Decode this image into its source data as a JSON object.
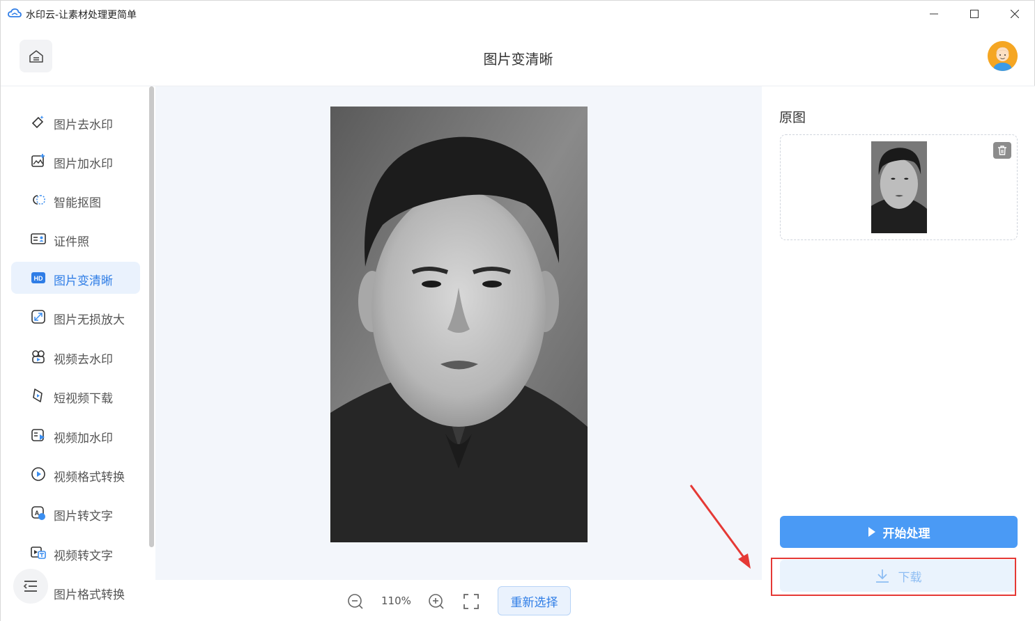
{
  "window": {
    "title": "水印云-让素材处理更简单",
    "controls": [
      "minimize-icon",
      "maximize-icon",
      "close-icon"
    ]
  },
  "header": {
    "title": "图片变清晰"
  },
  "sidebar": {
    "items": [
      {
        "label": "图片去水印",
        "icon": "eraser-icon",
        "active": false
      },
      {
        "label": "图片加水印",
        "icon": "image-add-icon",
        "active": false
      },
      {
        "label": "智能抠图",
        "icon": "cutout-icon",
        "active": false
      },
      {
        "label": "证件照",
        "icon": "id-card-icon",
        "active": false
      },
      {
        "label": "图片变清晰",
        "icon": "hd-icon",
        "active": true
      },
      {
        "label": "图片无损放大",
        "icon": "enlarge-icon",
        "active": false
      },
      {
        "label": "视频去水印",
        "icon": "video-eraser-icon",
        "active": false
      },
      {
        "label": "短视频下载",
        "icon": "video-download-icon",
        "active": false
      },
      {
        "label": "视频加水印",
        "icon": "video-watermark-icon",
        "active": false
      },
      {
        "label": "视频格式转换",
        "icon": "video-convert-icon",
        "active": false
      },
      {
        "label": "图片转文字",
        "icon": "image-text-icon",
        "active": false
      },
      {
        "label": "视频转文字",
        "icon": "video-text-icon",
        "active": false
      },
      {
        "label": "图片格式转换",
        "icon": "image-convert-icon",
        "active": false
      }
    ]
  },
  "toolbar": {
    "zoom": "110%",
    "reselect_label": "重新选择"
  },
  "right_panel": {
    "original_label": "原图",
    "start_label": "开始处理",
    "download_label": "下载"
  },
  "colors": {
    "accent": "#2f7de6",
    "primary_button": "#4a9af5",
    "highlight": "#e53935"
  }
}
